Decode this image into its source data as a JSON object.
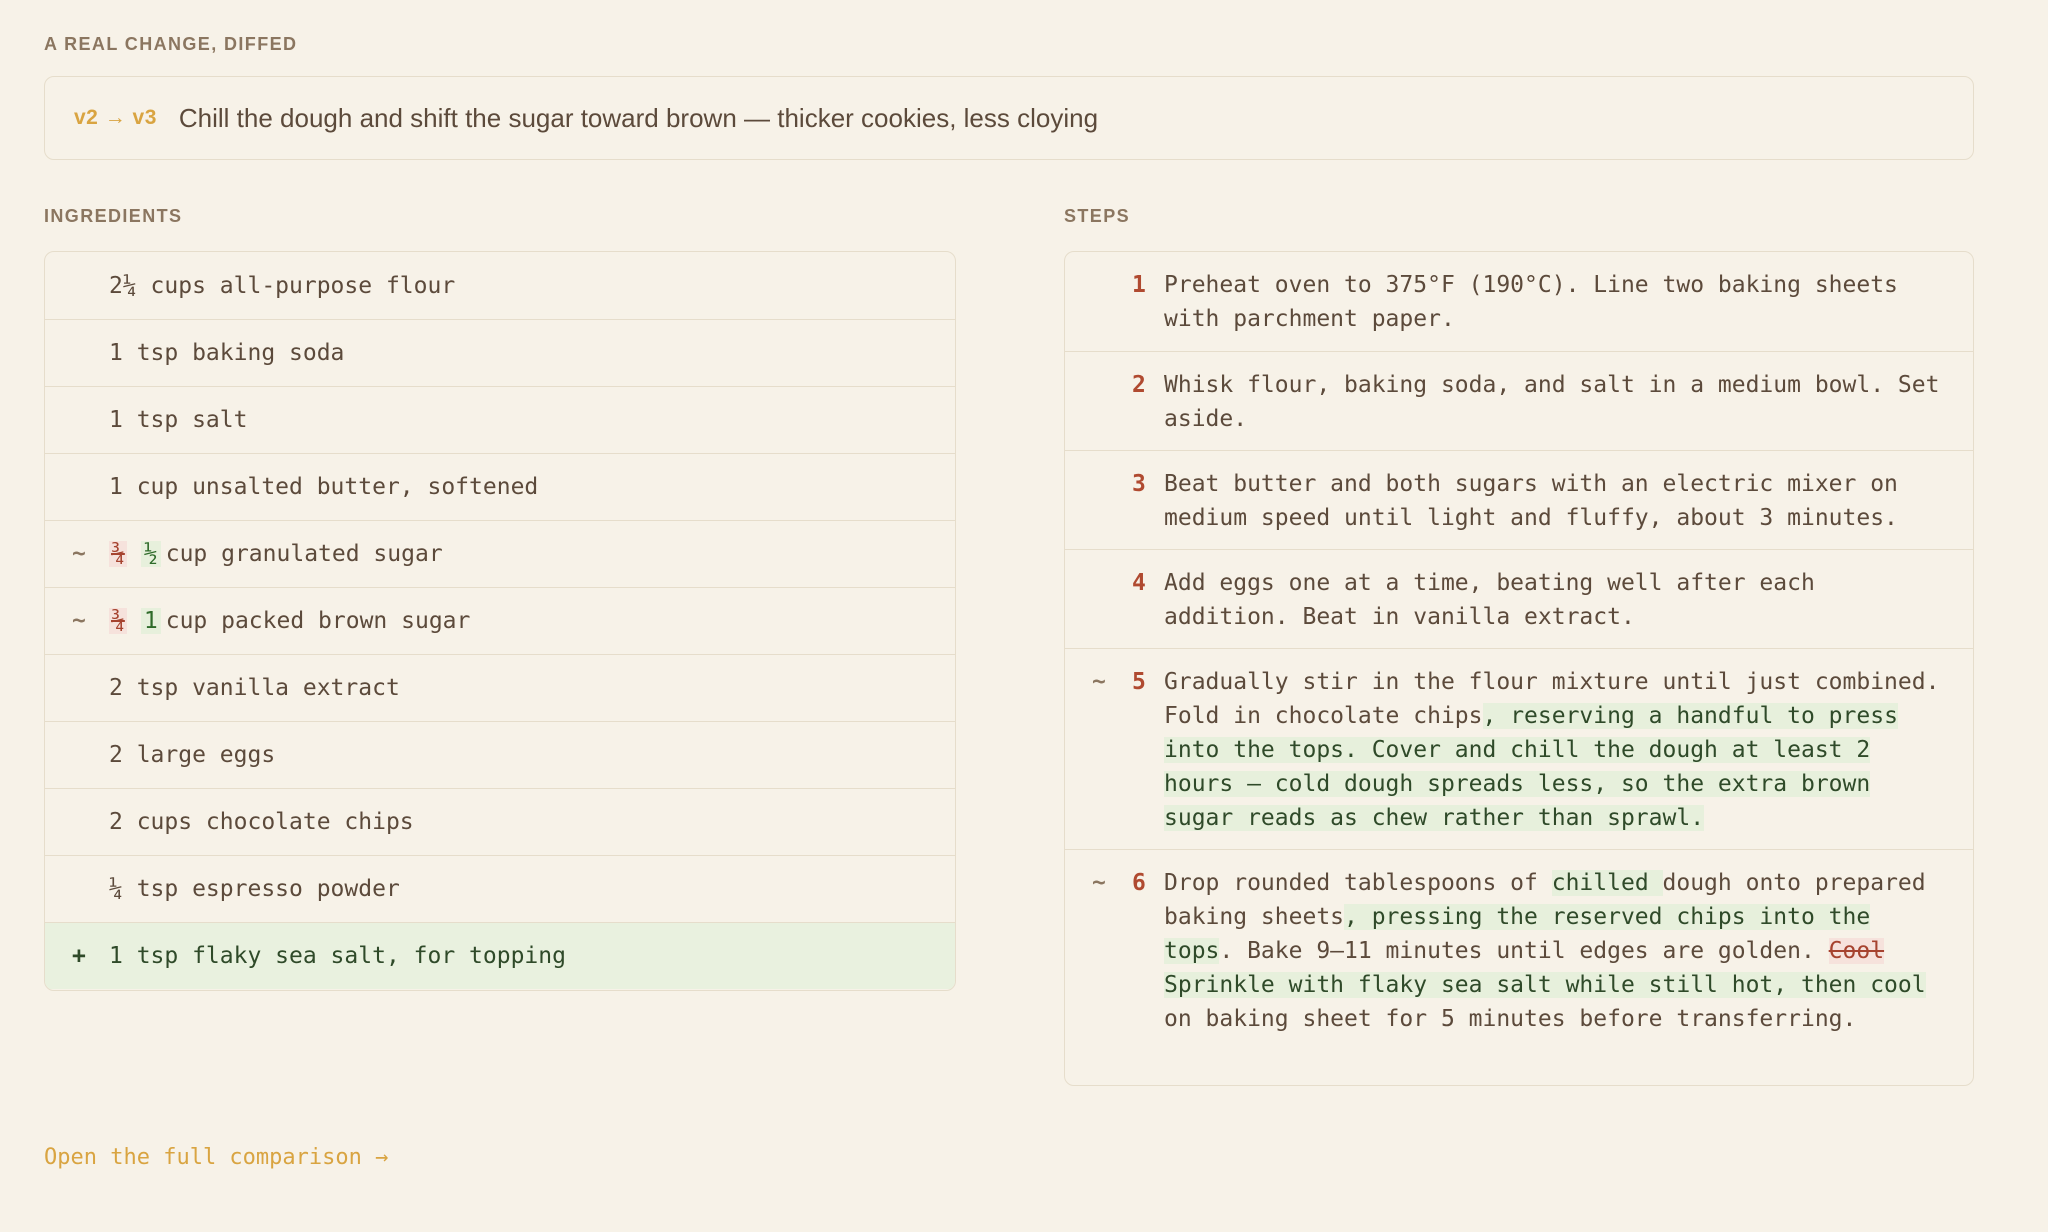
{
  "header": {
    "title": "A REAL CHANGE, DIFFED"
  },
  "banner": {
    "versions": "v2 → v3",
    "summary": "Chill the dough and shift the sugar toward brown — thicker cookies, less cloying"
  },
  "ingredients": {
    "title": "INGREDIENTS",
    "rows": [
      {
        "text": "2¼ cups all-purpose flour"
      },
      {
        "text": "1 tsp baking soda"
      },
      {
        "text": "1 tsp salt"
      },
      {
        "text": "1 cup unsalted butter, softened"
      },
      {
        "marker": "~",
        "old": "¾",
        "new": "½",
        "text": "cup granulated sugar"
      },
      {
        "marker": "~",
        "old": "¾",
        "new": "1",
        "text": "cup packed brown sugar"
      },
      {
        "text": "2 tsp vanilla extract"
      },
      {
        "text": "2 large eggs"
      },
      {
        "text": "2 cups chocolate chips"
      },
      {
        "text": "¼ tsp espresso powder"
      },
      {
        "marker": "+",
        "text": "1 tsp flaky sea salt, for topping"
      }
    ]
  },
  "steps": {
    "title": "STEPS",
    "rows": [
      {
        "num": "1",
        "text": "Preheat oven to 375°F (190°C). Line two baking sheets with parchment paper."
      },
      {
        "num": "2",
        "text": "Whisk flour, baking soda, and salt in a medium bowl. Set aside."
      },
      {
        "num": "3",
        "text": "Beat butter and both sugars with an electric mixer on medium speed until light and fluffy, about 3 minutes."
      },
      {
        "num": "4",
        "text": "Add eggs one at a time, beating well after each addition. Beat in vanilla extract."
      },
      {
        "num": "5",
        "marker": "~",
        "text_a": "Gradually stir in the flour mixture until just combined. Fold in chocolate chips",
        "added_a": ", reserving a handful to press into the tops. Cover and chill the dough at least 2 hours — cold dough spreads less, so the extra brown sugar reads as chew rather than sprawl."
      },
      {
        "num": "6",
        "marker": "~",
        "text_a": "Drop rounded tablespoons of ",
        "added_a": "chilled ",
        "text_b": "dough onto prepared baking sheets",
        "added_b": ", pressing the reserved chips into the tops",
        "text_c": ". Bake 9–11 minutes until edges are golden.  ",
        "removed": "Cool",
        "added_c": " Sprinkle with flaky sea salt while still hot, then cool",
        "text_d": " on baking sheet for 5 minutes before transferring."
      }
    ]
  },
  "footer": {
    "link": "Open the full comparison →"
  }
}
